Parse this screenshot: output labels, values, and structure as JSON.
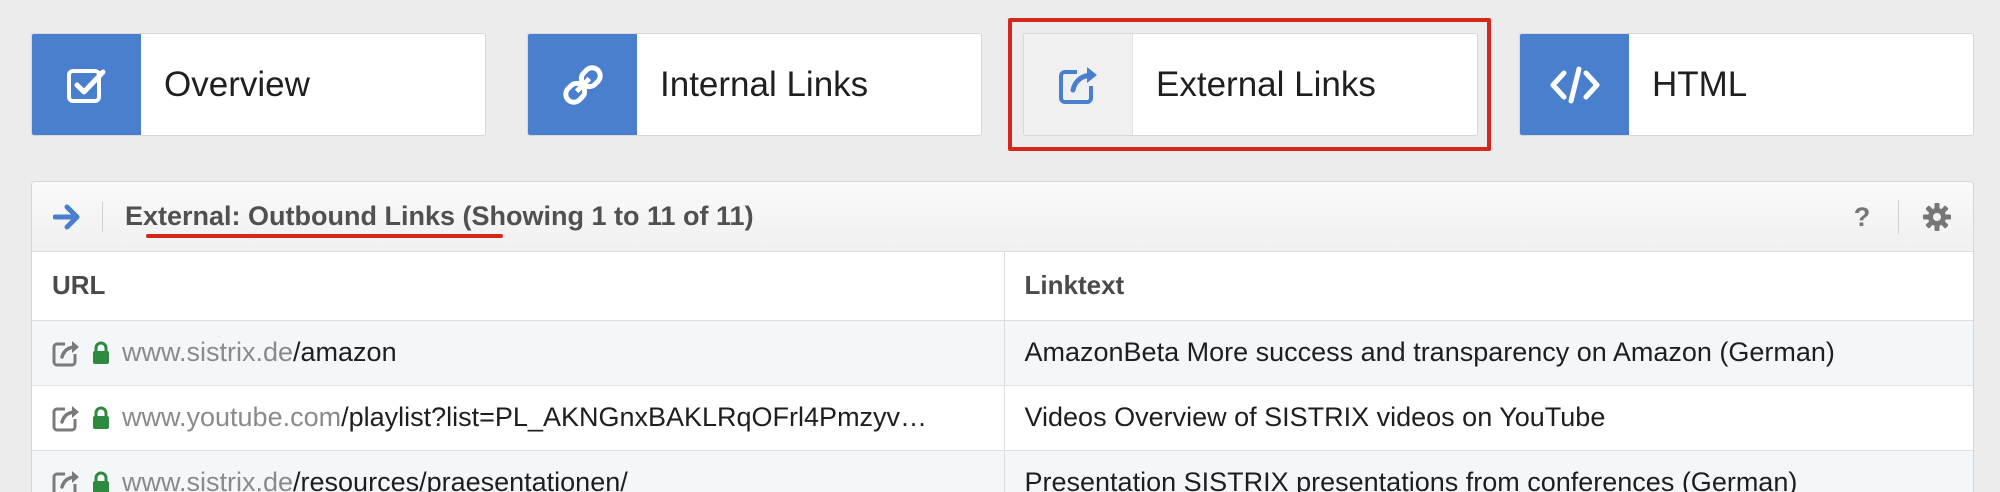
{
  "tabs": [
    {
      "label": "Overview",
      "icon": "checkbox-icon",
      "active": false
    },
    {
      "label": "Internal Links",
      "icon": "link-icon",
      "active": false
    },
    {
      "label": "External Links",
      "icon": "external-link-icon",
      "active": true
    },
    {
      "label": "HTML",
      "icon": "code-icon",
      "active": false
    }
  ],
  "panel": {
    "title_main": "External: Outbound Links",
    "title_suffix": " (Showing 1 to 11 of 11)",
    "help_label": "?",
    "columns": {
      "url": "URL",
      "linktext": "Linktext"
    },
    "rows": [
      {
        "domain": "www.sistrix.de",
        "path": "/amazon",
        "linktext": "AmazonBeta More success and transparency on Amazon (German)"
      },
      {
        "domain": "www.youtube.com",
        "path": "/playlist?list=PL_AKNGnxBAKLRqOFrl4Pmzyv…",
        "linktext": "Videos Overview of SISTRIX videos on YouTube"
      },
      {
        "domain": "www.sistrix.de",
        "path": "/resources/praesentationen/",
        "linktext": "Presentation SISTRIX presentations from conferences (German)"
      }
    ]
  },
  "colors": {
    "accent": "#4a7fce",
    "highlight": "#d5271c",
    "lock": "#2e8b3e"
  }
}
